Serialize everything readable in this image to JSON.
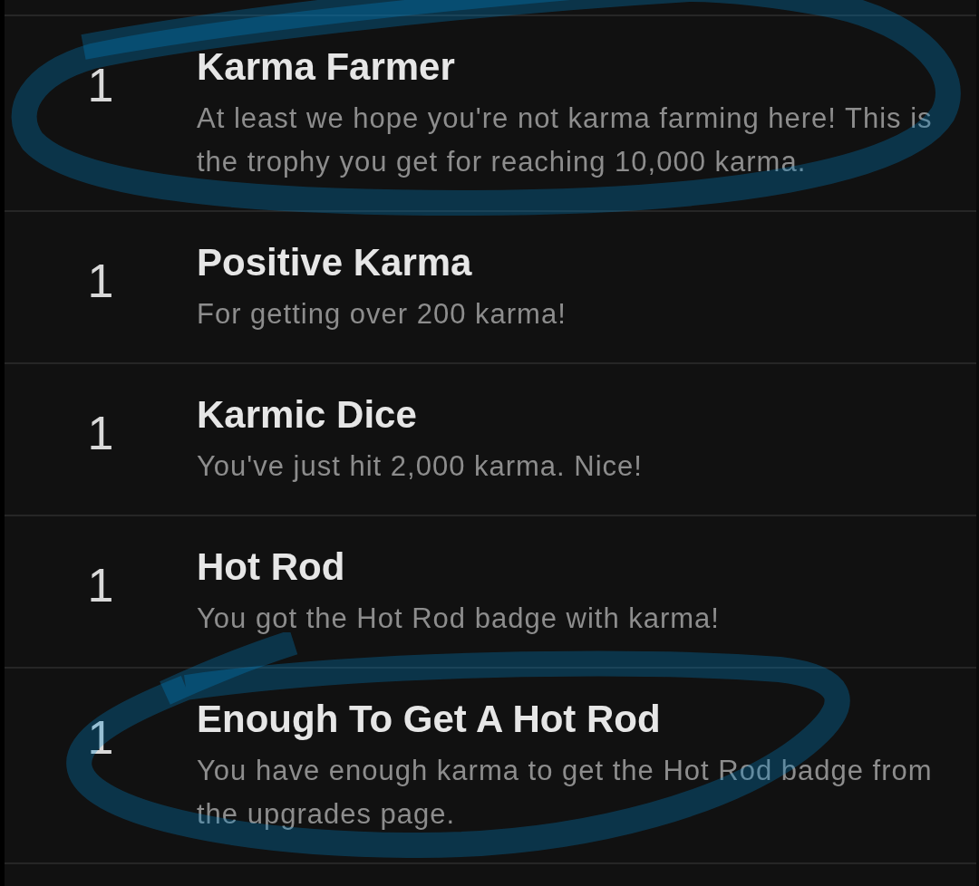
{
  "trophies": [
    {
      "count": "1",
      "title": "Karma Farmer",
      "description": "At least we hope you're not karma farming here! This is the trophy you get for reaching 10,000 karma.",
      "circled": true
    },
    {
      "count": "1",
      "title": "Positive Karma",
      "description": "For getting over 200 karma!",
      "circled": false
    },
    {
      "count": "1",
      "title": "Karmic Dice",
      "description": "You've just hit 2,000 karma. Nice!",
      "circled": false
    },
    {
      "count": "1",
      "title": "Hot Rod",
      "description": "You got the Hot Rod badge with karma!",
      "circled": false
    },
    {
      "count": "1",
      "title": "Enough To Get A Hot Rod",
      "description": "You have enough karma to get the Hot Rod badge from the upgrades page.",
      "circled": true
    }
  ]
}
